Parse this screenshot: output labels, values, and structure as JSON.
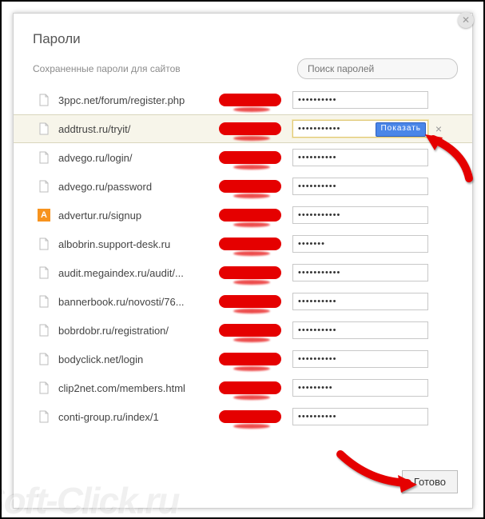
{
  "window": {
    "title": "Пароли",
    "saved_label": "Сохраненные пароли для сайтов",
    "search_placeholder": "Поиск паролей",
    "done_label": "Готово",
    "show_label": "Показать",
    "watermark": "Soft-Click.ru"
  },
  "rows": [
    {
      "site": "3ppc.net/forum/register.php",
      "icon": "doc",
      "pw": "••••••••••",
      "selected": false
    },
    {
      "site": "addtrust.ru/tryit/",
      "icon": "doc",
      "pw": "•••••••••••",
      "selected": true
    },
    {
      "site": "advego.ru/login/",
      "icon": "doc",
      "pw": "••••••••••",
      "selected": false
    },
    {
      "site": "advego.ru/password",
      "icon": "doc",
      "pw": "••••••••••",
      "selected": false
    },
    {
      "site": "advertur.ru/signup",
      "icon": "adv",
      "pw": "•••••••••••",
      "selected": false
    },
    {
      "site": "albobrin.support-desk.ru",
      "icon": "doc",
      "pw": "•••••••",
      "selected": false
    },
    {
      "site": "audit.megaindex.ru/audit/...",
      "icon": "doc",
      "pw": "•••••••••••",
      "selected": false
    },
    {
      "site": "bannerbook.ru/novosti/76...",
      "icon": "doc",
      "pw": "••••••••••",
      "selected": false
    },
    {
      "site": "bobrdobr.ru/registration/",
      "icon": "doc",
      "pw": "••••••••••",
      "selected": false
    },
    {
      "site": "bodyclick.net/login",
      "icon": "doc",
      "pw": "••••••••••",
      "selected": false
    },
    {
      "site": "clip2net.com/members.html",
      "icon": "doc",
      "pw": "•••••••••",
      "selected": false
    },
    {
      "site": "conti-group.ru/index/1",
      "icon": "doc",
      "pw": "••••••••••",
      "selected": false
    }
  ]
}
